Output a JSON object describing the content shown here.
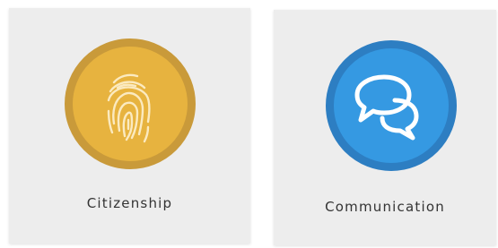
{
  "cards": [
    {
      "label": "Citizenship",
      "icon": "fingerprint-icon",
      "accent": "#e7b33f",
      "ring": "#c99a3a"
    },
    {
      "label": "Communication",
      "icon": "speech-bubbles-icon",
      "accent": "#3599e2",
      "ring": "#2d7ec2"
    }
  ],
  "colors": {
    "card_background": "#ededed",
    "label_text": "#333333",
    "icon_stroke": "#ffffff"
  }
}
